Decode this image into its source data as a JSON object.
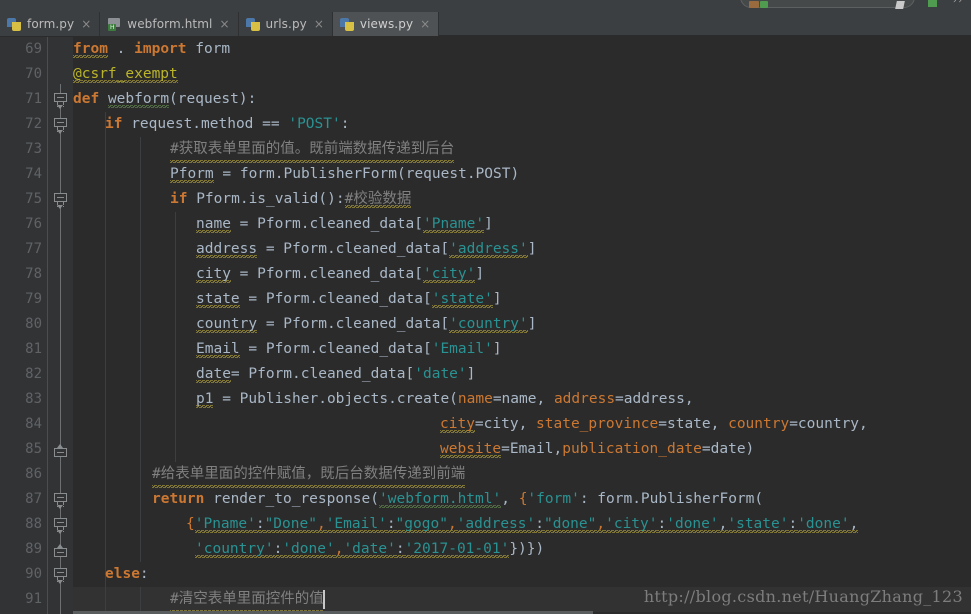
{
  "window": {
    "theme_background": "#2b2b2b",
    "gutter_background": "#313335",
    "tabbar_background": "#3c3f41",
    "accent_keyword": "#cc7832",
    "accent_string": "#2a9292",
    "accent_comment": "#808080",
    "accent_decorator": "#bbb529",
    "accent_function": "#ffc66d"
  },
  "tabs": [
    {
      "label": "form.py",
      "icon": "python-file-icon",
      "close": "×",
      "active": false
    },
    {
      "label": "webform.html",
      "icon": "html-file-icon",
      "close": "×",
      "active": false
    },
    {
      "label": "urls.py",
      "icon": "python-file-icon",
      "close": "×",
      "active": false
    },
    {
      "label": "views.py",
      "icon": "python-file-icon",
      "close": "×",
      "active": true
    }
  ],
  "toolbar": {
    "search_placeholder": "",
    "search_value": ""
  },
  "editor": {
    "first_line_number": 69,
    "last_line_number": 91,
    "line_numbers": [
      69,
      70,
      71,
      72,
      73,
      74,
      75,
      76,
      77,
      78,
      79,
      80,
      81,
      82,
      83,
      84,
      85,
      86,
      87,
      88,
      89,
      90,
      91
    ],
    "lines": [
      {
        "n": 69,
        "text": "from . import form"
      },
      {
        "n": 70,
        "text": "@csrf_exempt"
      },
      {
        "n": 71,
        "text": "def webform(request):"
      },
      {
        "n": 72,
        "text": "    if request.method == 'POST':"
      },
      {
        "n": 73,
        "text": "        #获取表单里面的值。既前端数据传递到后台"
      },
      {
        "n": 74,
        "text": "        Pform = form.PublisherForm(request.POST)"
      },
      {
        "n": 75,
        "text": "        if Pform.is_valid():#校验数据"
      },
      {
        "n": 76,
        "text": "            name = Pform.cleaned_data['Pname']"
      },
      {
        "n": 77,
        "text": "            address = Pform.cleaned_data['address']"
      },
      {
        "n": 78,
        "text": "            city = Pform.cleaned_data['city']"
      },
      {
        "n": 79,
        "text": "            state = Pform.cleaned_data['state']"
      },
      {
        "n": 80,
        "text": "            country = Pform.cleaned_data['country']"
      },
      {
        "n": 81,
        "text": "            Email = Pform.cleaned_data['Email']"
      },
      {
        "n": 82,
        "text": "            date= Pform.cleaned_data['date']"
      },
      {
        "n": 83,
        "text": "            p1 = Publisher.objects.create(name=name, address=address,"
      },
      {
        "n": 84,
        "text": "                                 city=city, state_province=state, country=country,"
      },
      {
        "n": 85,
        "text": "                                 website=Email,publication_date=date)"
      },
      {
        "n": 86,
        "text": "        #给表单里面的控件赋值，既后台数据传递到前端"
      },
      {
        "n": 87,
        "text": "        return render_to_response('webform.html', {'form': form.PublisherForm("
      },
      {
        "n": 88,
        "text": "            {'Pname':\"Done\",'Email':\"gogo\",'address':\"done\",'city':'done','state':'done',"
      },
      {
        "n": 89,
        "text": "             'country':'done','date':'2017-01-01'})})"
      },
      {
        "n": 90,
        "text": "    else:"
      },
      {
        "n": 91,
        "text": "        #清空表单里面控件的值"
      }
    ],
    "fold_marker_lines": [
      71,
      72,
      75,
      85,
      87,
      88,
      89,
      90
    ],
    "caret_line": 91
  },
  "watermark": {
    "text": "http://blog.csdn.net/HuangZhang_123"
  },
  "tokens": {
    "l69_from": "from",
    "l69_dot": " . ",
    "l69_import": "import",
    "l69_form": " form",
    "l70_at": "@",
    "l70_deco": "csrf_exempt",
    "l71_def": "def",
    "l71_name": "webform",
    "l71_rest": "(request):",
    "l72_if": "if",
    "l72_expr": " request.method == ",
    "l72_str": "'POST'",
    "l72_colon": ":",
    "l73_cmt": "#获取表单里面的值。既前端数据传递到后台",
    "l74_a": "Pform",
    "l74_b": " = form.PublisherForm(request.POST)",
    "l75_if": "if",
    "l75_expr": " Pform.is_valid():",
    "l75_cmt": "#校验数据",
    "l76_var": "name",
    "l76_mid": " = Pform.cleaned_data[",
    "l76_str": "'Pname'",
    "l76_end": "]",
    "l77_var": "address",
    "l77_str": "'address'",
    "l78_var": "city",
    "l78_str": "'city'",
    "l79_var": "state",
    "l79_str": "'state'",
    "l80_var": "country",
    "l80_str": "'country'",
    "l81_var": "Email",
    "l81_str": "'Email'",
    "l82_var": "date",
    "l82_mid": "= Pform.cleaned_data[",
    "l82_str": "'date'",
    "l83_p1": "p1",
    "l83_mid": " = Publisher.objects.create(",
    "l83_k1": "name",
    "l83_v1": "=name, ",
    "l83_k2": "address",
    "l83_v2": "=address,",
    "l84_k1": "city",
    "l84_v1": "=city, ",
    "l84_k2": "state_province",
    "l84_v2": "=state, ",
    "l84_k3": "country",
    "l84_v3": "=country,",
    "l85_k1": "website",
    "l85_v1": "=Email,",
    "l85_k2": "publication_date",
    "l85_v2": "=date)",
    "l86_cmt": "#给表单里面的控件赋值，既后台数据传递到前端",
    "l87_ret": "return",
    "l87_fn": " render_to_response(",
    "l87_str": "'webform.html'",
    "l87_c1": ", ",
    "l87_br": "{",
    "l87_str2": "'form'",
    "l87_c2": ": form.PublisherForm(",
    "l88_br": "{",
    "l88_s1": "'Pname'",
    "l88_c1": ":",
    "l88_s2": "\"Done\"",
    "l88_c2": ",",
    "l88_s3": "'Email'",
    "l88_c3": ":",
    "l88_s4": "\"gogo\"",
    "l88_c4": ",",
    "l88_s5": "'address'",
    "l88_c5": ":",
    "l88_s6": "\"done\"",
    "l88_c6": ",",
    "l88_s7": "'city'",
    "l88_c7": ":",
    "l88_s8": "'done'",
    "l88_c8": ",",
    "l88_s9": "'state'",
    "l88_c9": ":",
    "l88_s10": "'done'",
    "l88_c10": ",",
    "l89_s1": "'country'",
    "l89_c1": ":",
    "l89_s2": "'done'",
    "l89_c2": ",",
    "l89_s3": "'date'",
    "l89_c3": ":",
    "l89_s4": "'2017-01-01'",
    "l89_end": "})})",
    "l90_else": "else",
    "l90_colon": ":",
    "l91_cmt": "#清空表单里面控件的值"
  }
}
